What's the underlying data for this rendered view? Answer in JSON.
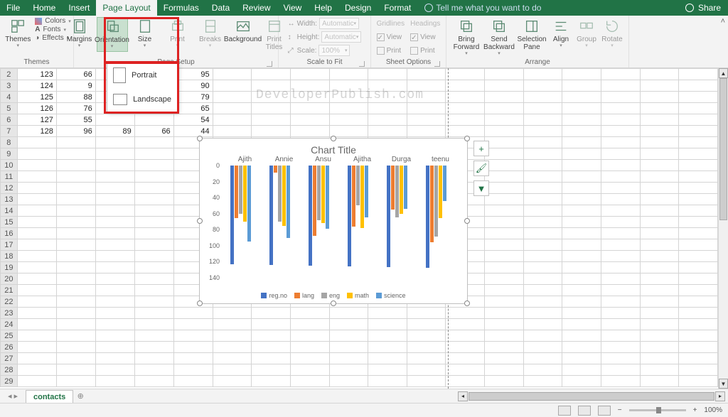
{
  "titlebar": {
    "tabs": [
      "File",
      "Home",
      "Insert",
      "Page Layout",
      "Formulas",
      "Data",
      "Review",
      "View",
      "Help",
      "Design",
      "Format"
    ],
    "active_index": 3,
    "tell_me": "Tell me what you want to do",
    "share": "Share"
  },
  "ribbon": {
    "themes": {
      "label": "Themes",
      "btn": "Themes",
      "colors": "Colors",
      "fonts": "Fonts",
      "effects": "Effects"
    },
    "page_setup": {
      "label": "Page Setup",
      "margins": "Margins",
      "orientation": "Orientation",
      "size": "Size",
      "print": "Print",
      "breaks": "Breaks",
      "background": "Background",
      "print_titles": "Print\nTitles"
    },
    "scale": {
      "label": "Scale to Fit",
      "width": "Width:",
      "height": "Height:",
      "scale": "Scale:",
      "auto": "Automatic",
      "pct": "100%"
    },
    "sheet_opts": {
      "label": "Sheet Options",
      "gridlines": "Gridlines",
      "headings": "Headings",
      "view": "View",
      "print": "Print"
    },
    "arrange": {
      "label": "Arrange",
      "bring": "Bring\nForward",
      "send": "Send\nBackward",
      "selpane": "Selection\nPane",
      "align": "Align",
      "group": "Group",
      "rotate": "Rotate"
    }
  },
  "orientation_menu": {
    "portrait": "Portrait",
    "landscape": "Landscape"
  },
  "watermark": "DeveloperPublish.com",
  "grid": {
    "rows": [
      {
        "r": 2,
        "c": [
          123,
          66,
          null,
          null,
          95
        ]
      },
      {
        "r": 3,
        "c": [
          124,
          9,
          null,
          null,
          90
        ]
      },
      {
        "r": 4,
        "c": [
          125,
          88,
          null,
          null,
          79
        ]
      },
      {
        "r": 5,
        "c": [
          126,
          76,
          null,
          null,
          65
        ]
      },
      {
        "r": 6,
        "c": [
          127,
          55,
          null,
          null,
          54
        ]
      },
      {
        "r": 7,
        "c": [
          128,
          96,
          89,
          66,
          44
        ]
      }
    ],
    "blank_rows": [
      8,
      9,
      10,
      11,
      12,
      13,
      14,
      15,
      16,
      17,
      18,
      19,
      20,
      21,
      22,
      23,
      24,
      25,
      26,
      27,
      28,
      29
    ]
  },
  "chart_data": {
    "type": "bar",
    "title": "Chart Title",
    "categories": [
      "Ajith",
      "Annie",
      "Ansu",
      "Ajitha",
      "Durga",
      "teenu"
    ],
    "series": [
      {
        "name": "reg.no",
        "color": "#4472c4",
        "values": [
          123,
          124,
          125,
          126,
          127,
          128
        ]
      },
      {
        "name": "lang",
        "color": "#ed7d31",
        "values": [
          66,
          9,
          88,
          76,
          55,
          96
        ]
      },
      {
        "name": "eng",
        "color": "#a5a5a5",
        "values": [
          60,
          70,
          68,
          50,
          65,
          89
        ]
      },
      {
        "name": "math",
        "color": "#ffc000",
        "values": [
          70,
          75,
          72,
          78,
          60,
          66
        ]
      },
      {
        "name": "science",
        "color": "#5b9bd5",
        "values": [
          95,
          90,
          79,
          65,
          54,
          44
        ]
      }
    ],
    "ylabel": "",
    "xlabel": "",
    "y_ticks": [
      0,
      20,
      40,
      60,
      80,
      100,
      120,
      140
    ],
    "ylim": [
      0,
      140
    ],
    "reversed_y": true
  },
  "chart_side": {
    "plus": "+",
    "brush": "🖌",
    "filter": "▼"
  },
  "sheet_tabs": {
    "active": "contacts"
  },
  "status": {
    "zoom": "100%",
    "minus": "−",
    "plus": "+"
  },
  "colors": {
    "s0": "#4472c4",
    "s1": "#ed7d31",
    "s2": "#a5a5a5",
    "s3": "#ffc000",
    "s4": "#5b9bd5"
  }
}
